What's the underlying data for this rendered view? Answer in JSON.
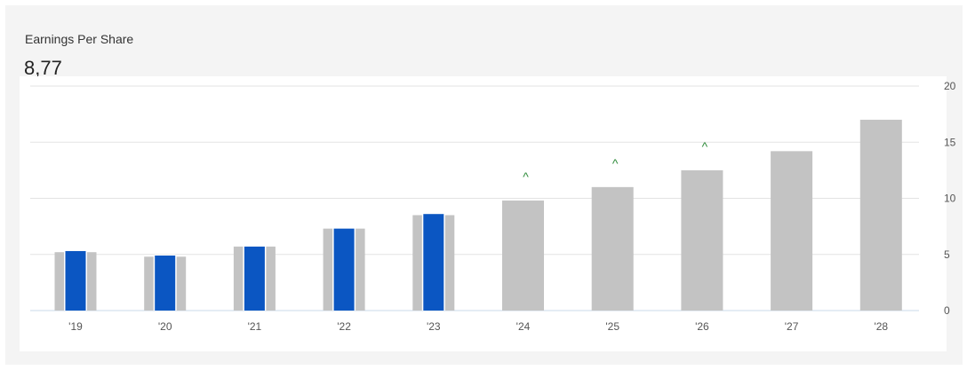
{
  "header": {
    "title": "Earnings Per Share",
    "value": "8,77"
  },
  "colors": {
    "actual": "#0b56c2",
    "estimate": "#c3c3c3",
    "grid": "#e3e3e3",
    "baseline": "#c9d9e8",
    "up_marker": "#2e8b3a"
  },
  "chart_data": {
    "type": "bar",
    "categories": [
      "'19",
      "'20",
      "'21",
      "'22",
      "'23",
      "'24",
      "'25",
      "'26",
      "'27",
      "'28"
    ],
    "series": [
      {
        "values": [
          5.2,
          4.8,
          5.7,
          7.3,
          8.5,
          9.8,
          11.0,
          12.5,
          14.2,
          17.0
        ]
      },
      {
        "values": [
          5.3,
          4.9,
          5.7,
          7.3,
          8.6,
          null,
          null,
          null,
          null,
          null
        ]
      }
    ],
    "up_markers": [
      "'24",
      "'25",
      "'26"
    ],
    "up_marker_symbol": "^",
    "ylim": [
      0,
      20
    ],
    "yticks": [
      0,
      5,
      10,
      15,
      20
    ],
    "y_axis_side": "right",
    "grid": true
  }
}
